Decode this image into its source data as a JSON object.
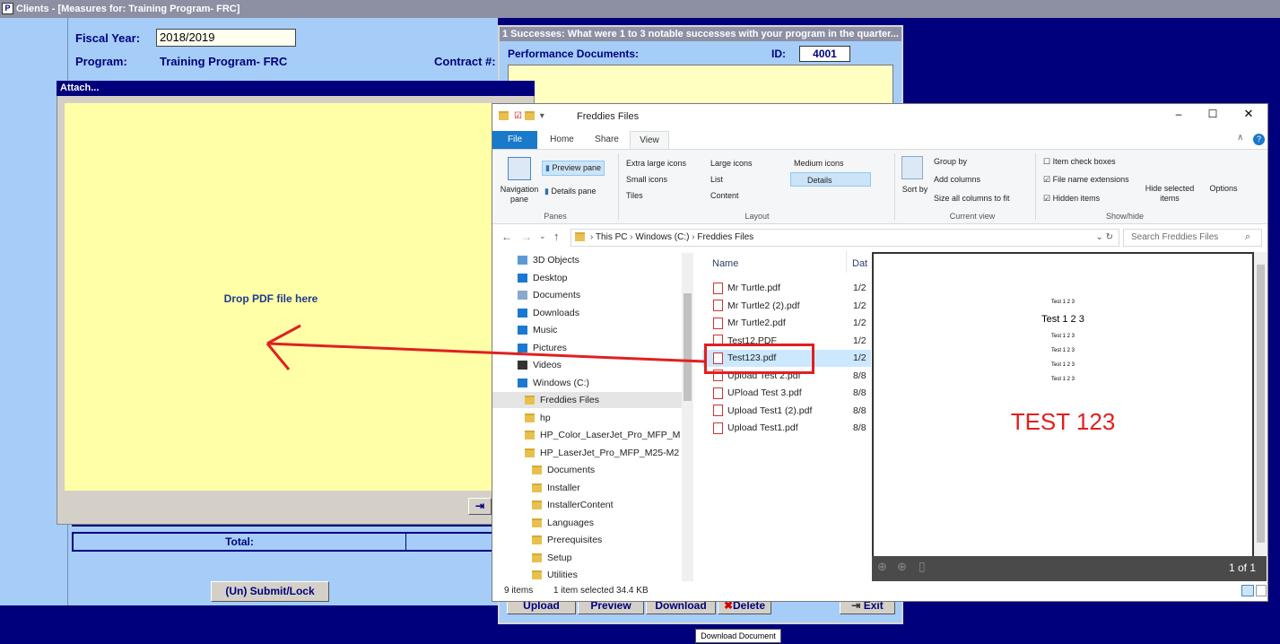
{
  "main_window": {
    "title": "Clients - [Measures for:  Training Program- FRC]"
  },
  "form": {
    "fiscal_year_label": "Fiscal Year:",
    "fiscal_year_value": "2018/2019",
    "program_label": "Program:",
    "program_value": "Training Program- FRC",
    "contract_label": "Contract #:",
    "total_label": "Total:",
    "submit_label": "(Un) Submit/Lock"
  },
  "right_panel": {
    "title": "1 Successes: What were 1 to 3 notable successes with your program in the quarter...",
    "perf_docs_label": "Performance Documents:",
    "id_label": "ID:",
    "id_value": "4001",
    "buttons": {
      "upload": "Upload",
      "preview": "Preview",
      "download": "Download",
      "delete": "Delete",
      "exit": "Exit"
    },
    "tooltip": "Download Document"
  },
  "attach_dialog": {
    "title": "Attach...",
    "drop_text": "Drop PDF file here"
  },
  "explorer": {
    "title": "Freddies Files",
    "tabs": [
      "File",
      "Home",
      "Share",
      "View"
    ],
    "ribbon": {
      "nav_pane": "Navigation pane",
      "preview_pane": "Preview pane",
      "details_pane": "Details pane",
      "panes_group": "Panes",
      "extra_large_icons": "Extra large icons",
      "large_icons": "Large icons",
      "medium_icons": "Medium icons",
      "small_icons": "Small icons",
      "list": "List",
      "details": "Details",
      "tiles": "Tiles",
      "content": "Content",
      "layout_group": "Layout",
      "sort_by": "Sort by",
      "group_by": "Group by",
      "add_columns": "Add columns",
      "size_columns": "Size all columns to fit",
      "current_view_group": "Current view",
      "item_check_boxes": "Item check boxes",
      "file_name_extensions": "File name extensions",
      "hidden_items": "Hidden items",
      "hide_selected": "Hide selected items",
      "options": "Options",
      "show_hide_group": "Show/hide"
    },
    "address": {
      "this_pc": "This PC",
      "drive": "Windows (C:)",
      "folder": "Freddies Files"
    },
    "search_placeholder": "Search Freddies Files",
    "nav_items": [
      "3D Objects",
      "Desktop",
      "Documents",
      "Downloads",
      "Music",
      "Pictures",
      "Videos",
      "Windows (C:)",
      "Freddies Files",
      "hp",
      "HP_Color_LaserJet_Pro_MFP_M",
      "HP_LaserJet_Pro_MFP_M25-M2",
      "Documents",
      "Installer",
      "InstallerContent",
      "Languages",
      "Prerequisites",
      "Setup",
      "Utilities"
    ],
    "columns": {
      "name": "Name",
      "date": "Dat"
    },
    "files": [
      {
        "name": "Mr Turtle.pdf",
        "date": "1/2"
      },
      {
        "name": "Mr Turtle2 (2).pdf",
        "date": "1/2"
      },
      {
        "name": "Mr Turtle2.pdf",
        "date": "1/2"
      },
      {
        "name": "Test12.PDF",
        "date": "1/2"
      },
      {
        "name": "Test123.pdf",
        "date": "1/2"
      },
      {
        "name": "Upload Test 2.pdf",
        "date": "8/8"
      },
      {
        "name": "UPload Test 3.pdf",
        "date": "8/8"
      },
      {
        "name": "Upload Test1 (2).pdf",
        "date": "8/8"
      },
      {
        "name": "Upload Test1.pdf",
        "date": "8/8"
      }
    ],
    "preview": {
      "small_line": "Test 1 2 3",
      "medium_line": "Test 1 2 3",
      "big_text": "TEST 123",
      "page_count": "1 of 1"
    },
    "status": {
      "items": "9 items",
      "selected": "1 item selected  34.4 KB"
    }
  },
  "colors": {
    "form_bg": "#a6cdf7",
    "desktop_bg": "#00007c",
    "drop_zone": "#ffffa8",
    "highlight_red": "#e02020"
  }
}
